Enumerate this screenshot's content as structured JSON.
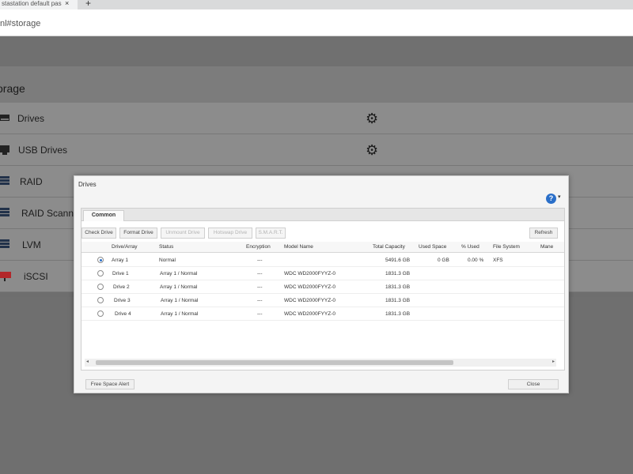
{
  "browser": {
    "tab_title": "stastation default pas",
    "tab_close": "×",
    "new_tab": "+",
    "url": "nl#storage"
  },
  "page": {
    "title": "orage",
    "rows": [
      {
        "label": "Drives",
        "icon": "drive-icon",
        "has_gear": true
      },
      {
        "label": "USB Drives",
        "icon": "usb-drive-icon",
        "has_gear": true
      },
      {
        "label": "RAID",
        "icon": "raid-icon",
        "has_gear": false
      },
      {
        "label": "RAID Scanning",
        "icon": "raid-scan-icon",
        "has_gear": false
      },
      {
        "label": "LVM",
        "icon": "lvm-icon",
        "has_gear": false
      },
      {
        "label": "iSCSI",
        "icon": "iscsi-icon",
        "has_gear": false
      }
    ],
    "gear_icon": "gear-icon"
  },
  "dialog": {
    "title": "Drives",
    "help": "?",
    "help_caret": "▾",
    "tab": "Common",
    "toolbar": {
      "check_drive": "Check Drive",
      "format_drive": "Format Drive",
      "unmount_drive": "Unmount Drive",
      "hotswap_drive": "Hotswap Drive",
      "smart": "S.M.A.R.T.",
      "refresh": "Refresh"
    },
    "columns": [
      "Drive/Array",
      "Status",
      "Encryption",
      "Model Name",
      "Total Capacity",
      "Used Space",
      "% Used",
      "File System",
      "Mane"
    ],
    "rows": [
      {
        "selected": true,
        "drive": "Array 1",
        "status": "Normal",
        "encryption": "---",
        "model": "",
        "capacity": "5491.6 GB",
        "used": "0 GB",
        "pct": "0.00 %",
        "fs": "XFS"
      },
      {
        "selected": false,
        "drive": "Drive 1",
        "status": "Array 1 / Normal",
        "encryption": "---",
        "model": "WDC WD2000FYYZ-0",
        "capacity": "1831.3 GB",
        "used": "",
        "pct": "",
        "fs": ""
      },
      {
        "selected": false,
        "drive": "Drive 2",
        "status": "Array 1 / Normal",
        "encryption": "---",
        "model": "WDC WD2000FYYZ-0",
        "capacity": "1831.3 GB",
        "used": "",
        "pct": "",
        "fs": ""
      },
      {
        "selected": false,
        "drive": "Drive 3",
        "status": "Array 1 / Normal",
        "encryption": "---",
        "model": "WDC WD2000FYYZ-0",
        "capacity": "1831.3 GB",
        "used": "",
        "pct": "",
        "fs": ""
      },
      {
        "selected": false,
        "drive": "Drive 4",
        "status": "Array 1 / Normal",
        "encryption": "---",
        "model": "WDC WD2000FYYZ-0",
        "capacity": "1831.3 GB",
        "used": "",
        "pct": "",
        "fs": ""
      }
    ],
    "scroll_left": "◂",
    "scroll_right": "▸",
    "free_space_alert": "Free Space Alert",
    "close": "Close"
  }
}
